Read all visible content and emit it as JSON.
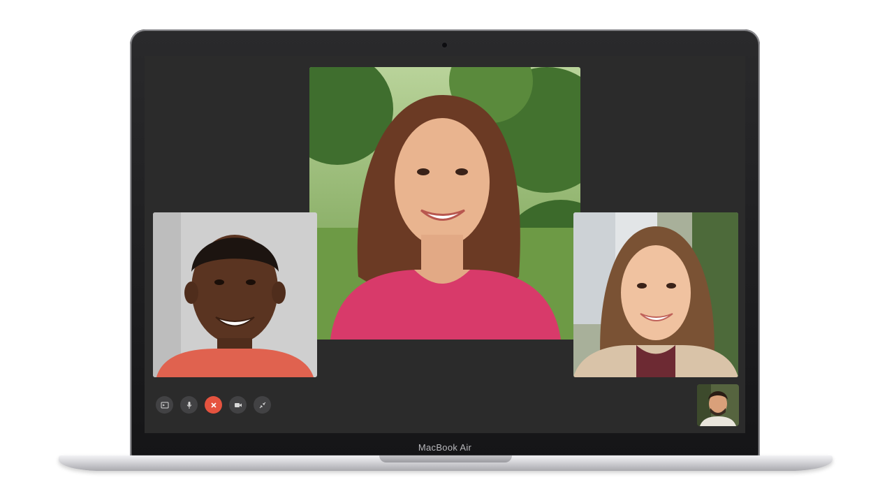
{
  "device": {
    "brand_label": "MacBook Air"
  },
  "call": {
    "participants": [
      {
        "tile": "main",
        "description_icon": "participant-video"
      },
      {
        "tile": "left",
        "description_icon": "participant-video"
      },
      {
        "tile": "right",
        "description_icon": "participant-video"
      }
    ],
    "self_view": {
      "tile": "self"
    }
  },
  "controls": [
    {
      "name": "sidebar-toggle-button",
      "icon": "sidebar-icon"
    },
    {
      "name": "mute-button",
      "icon": "microphone-icon"
    },
    {
      "name": "end-call-button",
      "icon": "close-icon",
      "color": "#e5533f"
    },
    {
      "name": "camera-button",
      "icon": "video-camera-icon"
    },
    {
      "name": "fullscreen-button",
      "icon": "collapse-arrows-icon"
    }
  ],
  "colors": {
    "screen_background": "#2b2b2b",
    "control_background": "#424244",
    "end_call": "#e5533f"
  }
}
